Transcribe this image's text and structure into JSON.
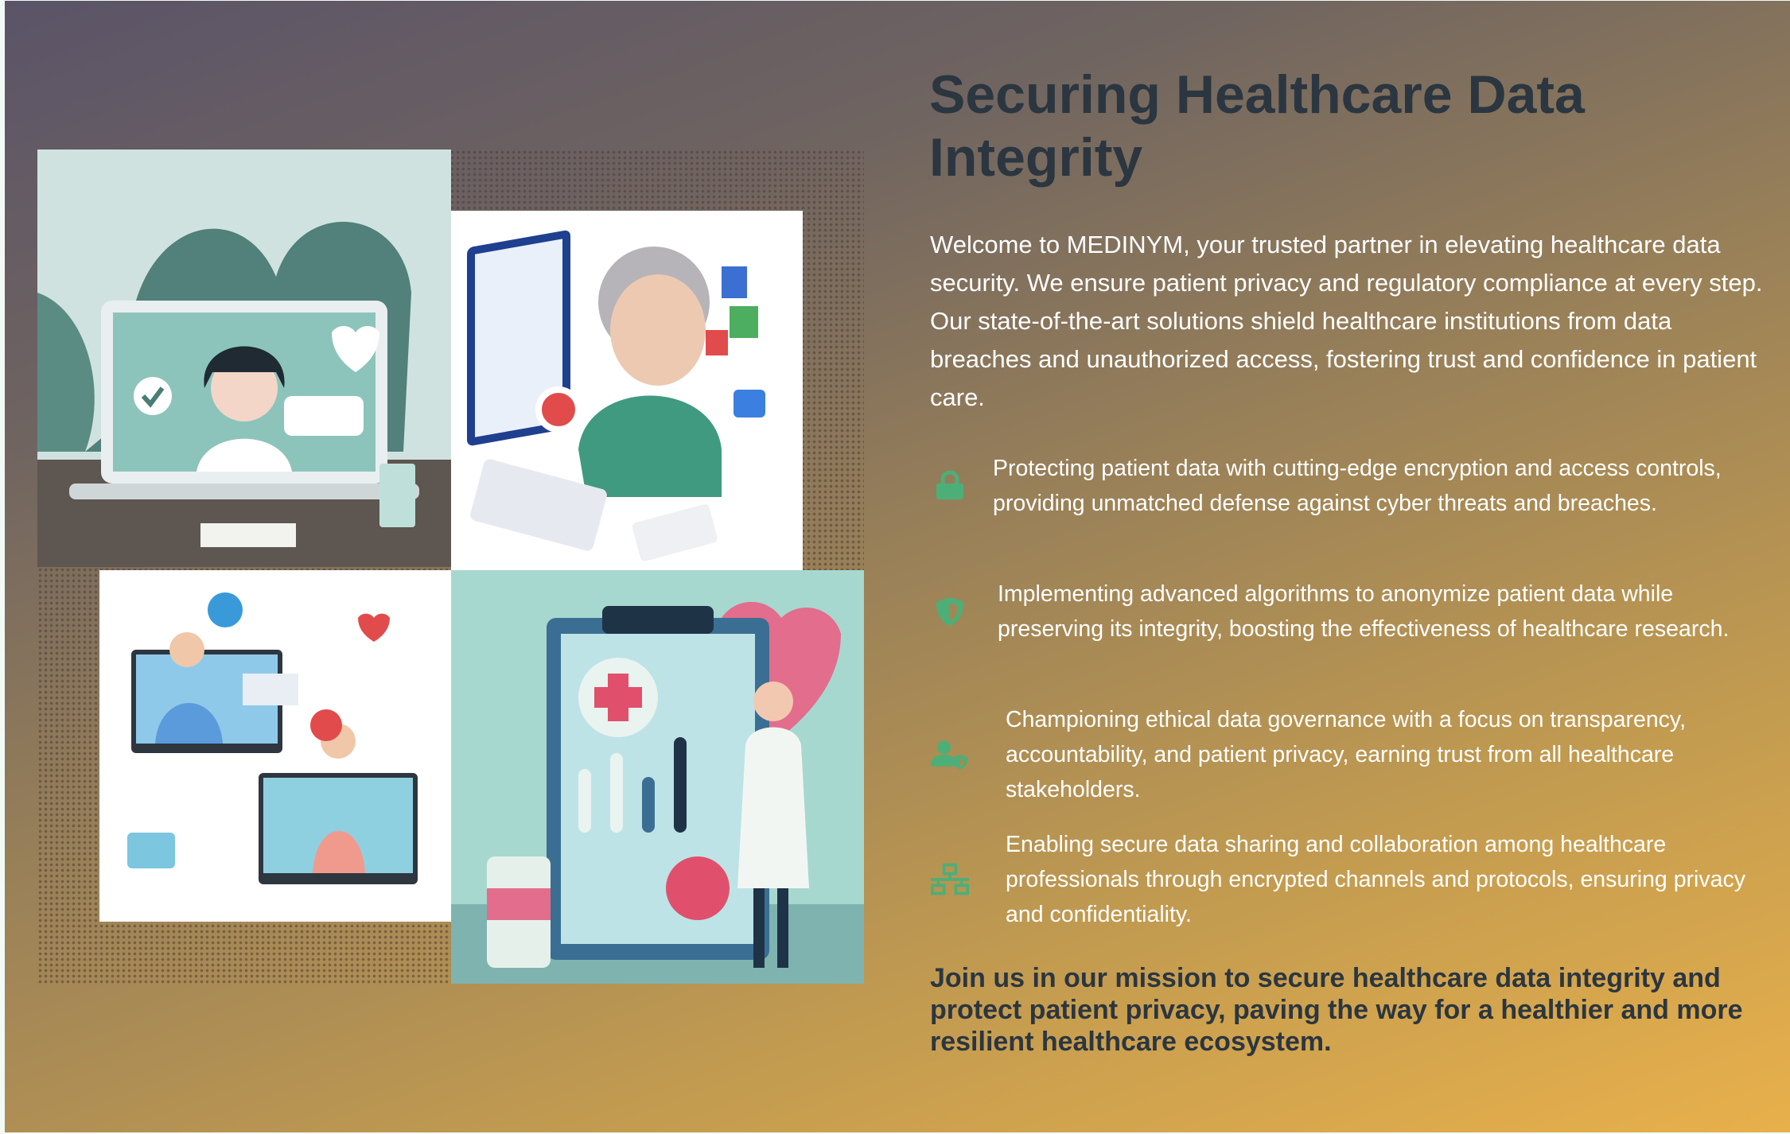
{
  "title": "Securing Healthcare Data Integrity",
  "intro": "Welcome to MEDINYM, your trusted partner in elevating healthcare data security. We ensure patient privacy and regulatory compliance at every step. Our state-of-the-art solutions shield healthcare institutions from data breaches and unauthorized access, fostering trust and confidence in patient care.",
  "features": [
    {
      "icon": "lock-icon",
      "text": "Protecting patient data with cutting-edge encryption and access controls, providing unmatched defense against cyber threats and breaches."
    },
    {
      "icon": "shield-icon",
      "text": "Implementing advanced algorithms to anonymize patient data while preserving its integrity, boosting the effectiveness of healthcare research."
    },
    {
      "icon": "user-shield-icon",
      "text": "Championing ethical data governance with a focus on transparency, accountability, and patient privacy, earning trust from all healthcare stakeholders."
    },
    {
      "icon": "network-icon",
      "text": "Enabling secure data sharing and collaboration among healthcare professionals through encrypted channels and protocols, ensuring privacy and confidentiality."
    }
  ],
  "closing": "Join us in our mission to secure healthcare data integrity and protect patient privacy, paving the way for a healthier and more resilient healthcare ecosystem.",
  "colors": {
    "icon": "#4caf78",
    "heading": "#2b3640",
    "body_text": "#ffffff",
    "gradient_start": "#5b5468",
    "gradient_end": "#e8b04b"
  }
}
